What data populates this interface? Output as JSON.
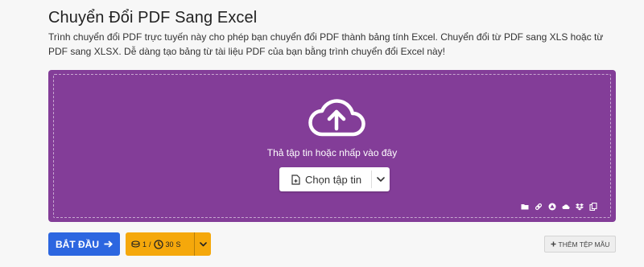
{
  "header": {
    "title": "Chuyển Đổi PDF Sang Excel",
    "description": "Trình chuyển đổi PDF trực tuyến này cho phép bạn chuyển đổi PDF thành bảng tính Excel. Chuyển đổi từ PDF sang XLS hoặc từ PDF sang XLSX. Dễ dàng tạo bảng từ tài liệu PDF của bạn bằng trình chuyển đổi Excel này!"
  },
  "dropzone": {
    "prompt": "Thả tập tin hoặc nhấp vào đây",
    "choose_file_label": "Chọn tập tin",
    "sources": [
      "folder-icon",
      "link-icon",
      "google-drive-icon",
      "onedrive-icon",
      "dropbox-icon",
      "clipboard-icon"
    ]
  },
  "actions": {
    "start_label": "BẮT ĐẦU",
    "credits": "1",
    "separator": "/",
    "time": "30",
    "time_unit": "S",
    "add_sample_label": "THÊM TỆP MẪU"
  },
  "colors": {
    "dropzone_bg": "#833d98",
    "start_bg": "#2c66e0",
    "credit_bg": "#f5a80b"
  }
}
